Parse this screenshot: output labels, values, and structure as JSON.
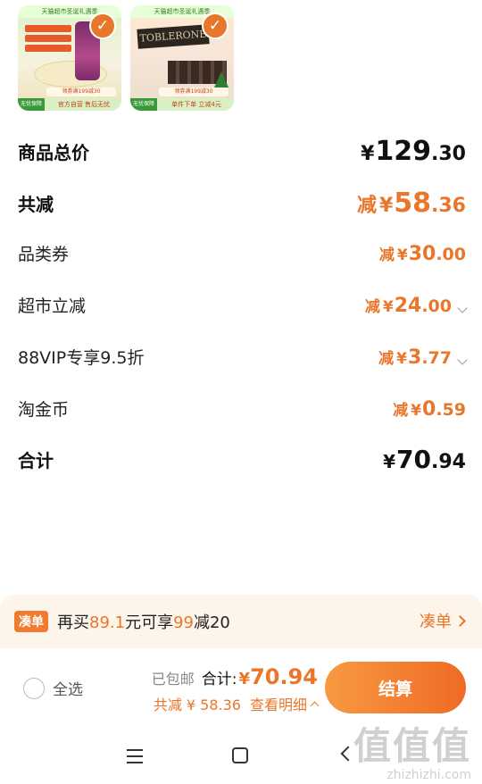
{
  "products": [
    {
      "banner": "天猫超市圣诞礼遇季",
      "promo": "领券满199减30",
      "guarantee": "无忧保障",
      "tag": "官方自营 售后无忧",
      "selected": true,
      "check_icon": "checkmark-icon"
    },
    {
      "banner": "天猫超市圣诞礼遇季",
      "brand": "TOBLERONE",
      "promo": "领券满199减30",
      "guarantee": "无忧保障",
      "tag": "单件下单 立减4元",
      "selected": true,
      "check_icon": "checkmark-icon"
    }
  ],
  "summary": {
    "subtotal": {
      "label": "商品总价",
      "yen": "¥",
      "int": "129",
      "dec": ".30"
    },
    "total_discount": {
      "label": "共减",
      "prefix": "减",
      "yen": "¥",
      "int": "58",
      "dec": ".36"
    },
    "lines": [
      {
        "label": "品类券",
        "prefix": "减",
        "yen": "¥",
        "int": "30",
        "dec": ".00",
        "expandable": false
      },
      {
        "label": "超市立减",
        "prefix": "减",
        "yen": "¥",
        "int": "24",
        "dec": ".00",
        "expandable": true
      },
      {
        "label": "88VIP专享9.5折",
        "prefix": "减",
        "yen": "¥",
        "int": "3",
        "dec": ".77",
        "expandable": true
      },
      {
        "label": "淘金币",
        "prefix": "减",
        "yen": "¥",
        "int": "0",
        "dec": ".59",
        "expandable": false
      }
    ],
    "grand_total": {
      "label": "合计",
      "yen": "¥",
      "int": "70",
      "dec": ".94"
    }
  },
  "addon": {
    "chip": "凑单",
    "text_before": "再买",
    "amount": "89.1",
    "text_mid": "元可享",
    "offer_num": "99",
    "offer_text": "减20",
    "link": "凑单"
  },
  "checkout": {
    "select_all": "全选",
    "shipping": "已包邮",
    "total_label": "合计:",
    "total_yen": "¥",
    "total_value": "70.94",
    "discount_text": "共减 ¥ 58.36",
    "detail_link": "查看明细",
    "pay_button": "结算"
  },
  "watermark": {
    "big": "值值值",
    "small": "zhizhizhi.com"
  },
  "colors": {
    "accent": "#e9772b",
    "button_start": "#f79a42",
    "button_end": "#f06a25",
    "banner_bg": "#fdf4ea"
  }
}
